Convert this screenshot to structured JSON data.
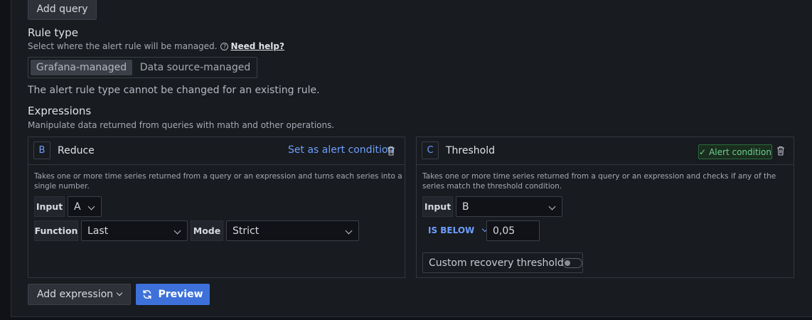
{
  "top": {
    "add_query_label": "Add query"
  },
  "rule_type": {
    "title": "Rule type",
    "description": "Select where the alert rule will be managed.",
    "help_link": "Need help?",
    "options": [
      {
        "label": "Grafana-managed",
        "active": true
      },
      {
        "label": "Data source-managed",
        "active": false
      }
    ],
    "note": "The alert rule type cannot be changed for an existing rule."
  },
  "expressions": {
    "title": "Expressions",
    "description": "Manipulate data returned from queries with math and other operations."
  },
  "reduce_card": {
    "ref": "B",
    "title": "Reduce",
    "set_condition_label": "Set as alert condition",
    "description": "Takes one or more time series returned from a query or an expression and turns each series into a single number.",
    "input_label": "Input",
    "input_value": "A",
    "function_label": "Function",
    "function_value": "Last",
    "mode_label": "Mode",
    "mode_value": "Strict"
  },
  "threshold_card": {
    "ref": "C",
    "title": "Threshold",
    "alert_condition_label": "Alert condition",
    "description": "Takes one or more time series returned from a query or an expression and checks if any of the series match the threshold condition.",
    "input_label": "Input",
    "input_value": "B",
    "operator": "IS BELOW",
    "threshold_value": "0,05",
    "recovery_label": "Custom recovery threshold",
    "recovery_enabled": false
  },
  "footer": {
    "add_expression_label": "Add expression",
    "preview_label": "Preview"
  },
  "colors": {
    "primary": "#3d71d9",
    "link": "#6e9fff",
    "success": "#6ccf8e"
  }
}
